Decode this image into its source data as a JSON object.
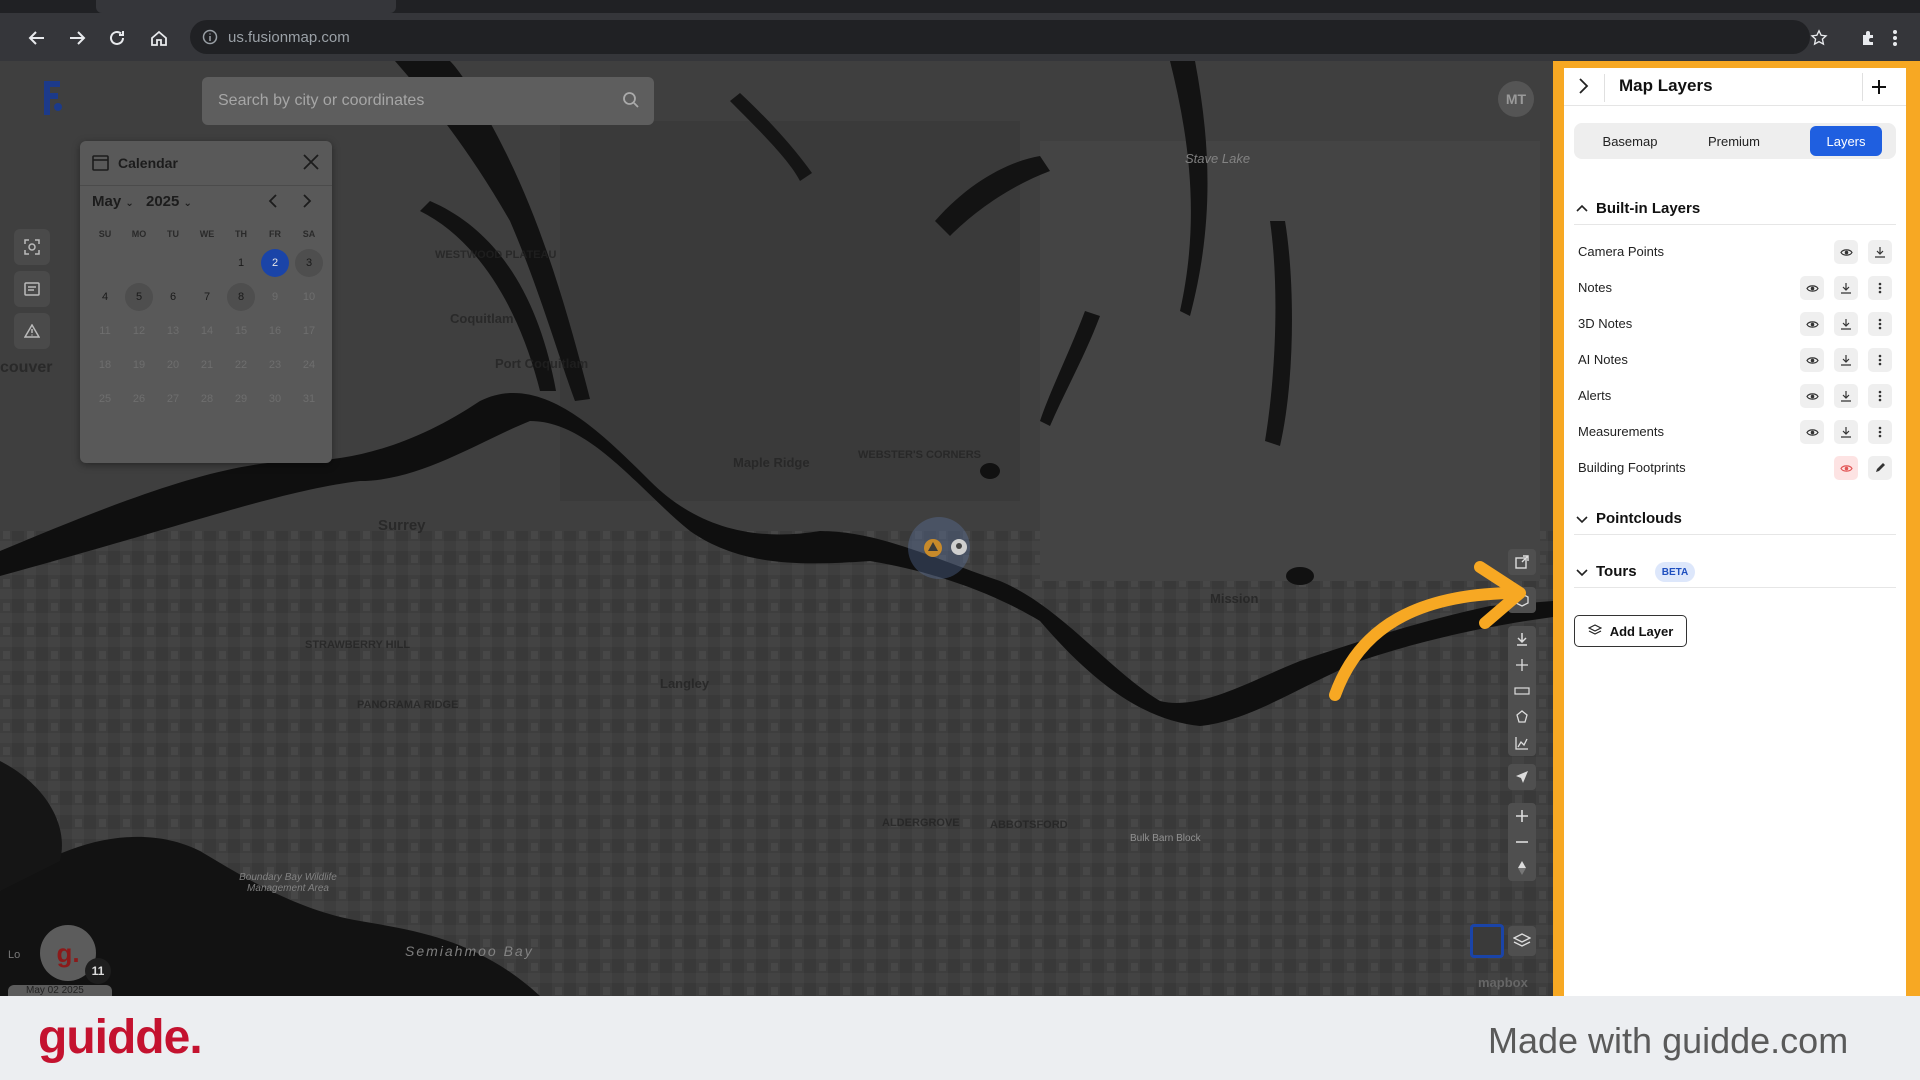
{
  "browser": {
    "url": "us.fusionmap.com"
  },
  "search": {
    "placeholder": "Search by city or coordinates"
  },
  "user": {
    "initials": "MT"
  },
  "calendar": {
    "title": "Calendar",
    "month": "May",
    "year": "2025",
    "weekdays": [
      "SU",
      "MO",
      "TU",
      "WE",
      "TH",
      "FR",
      "SA"
    ],
    "days": [
      {
        "d": "",
        "s": ""
      },
      {
        "d": "",
        "s": ""
      },
      {
        "d": "",
        "s": ""
      },
      {
        "d": "",
        "s": ""
      },
      {
        "d": "1",
        "s": ""
      },
      {
        "d": "2",
        "s": "sel"
      },
      {
        "d": "3",
        "s": "mark"
      },
      {
        "d": "4",
        "s": ""
      },
      {
        "d": "5",
        "s": "mark"
      },
      {
        "d": "6",
        "s": ""
      },
      {
        "d": "7",
        "s": ""
      },
      {
        "d": "8",
        "s": "mark"
      },
      {
        "d": "9",
        "s": "dim"
      },
      {
        "d": "10",
        "s": "dim"
      },
      {
        "d": "11",
        "s": "dim"
      },
      {
        "d": "12",
        "s": "dim"
      },
      {
        "d": "13",
        "s": "dim"
      },
      {
        "d": "14",
        "s": "dim"
      },
      {
        "d": "15",
        "s": "dim"
      },
      {
        "d": "16",
        "s": "dim"
      },
      {
        "d": "17",
        "s": "dim"
      },
      {
        "d": "18",
        "s": "dim"
      },
      {
        "d": "19",
        "s": "dim"
      },
      {
        "d": "20",
        "s": "dim"
      },
      {
        "d": "21",
        "s": "dim"
      },
      {
        "d": "22",
        "s": "dim"
      },
      {
        "d": "23",
        "s": "dim"
      },
      {
        "d": "24",
        "s": "dim"
      },
      {
        "d": "25",
        "s": "dim"
      },
      {
        "d": "26",
        "s": "dim"
      },
      {
        "d": "27",
        "s": "dim"
      },
      {
        "d": "28",
        "s": "dim"
      },
      {
        "d": "29",
        "s": "dim"
      },
      {
        "d": "30",
        "s": "dim"
      },
      {
        "d": "31",
        "s": "dim"
      }
    ]
  },
  "map": {
    "labels": [
      "couver",
      "Coquitlam",
      "Port Coquitlam",
      "Surrey",
      "Maple Ridge",
      "WEBSTER'S CORNERS",
      "STRAWBERRY HILL",
      "PANORAMA RIDGE",
      "ALDERGROVE",
      "ABBOTSFORD",
      "Mission",
      "Langley",
      "Bulk Barn Block",
      "Semiahmoo Bay",
      "Boundary Bay Wildlife Management Area",
      "WESTWOOD PLATEAU",
      "Stave Lake"
    ],
    "attribution": "mapbox",
    "notification_count": "11",
    "logo_alt": "Lo",
    "date_chip": "May 02 2025"
  },
  "panel": {
    "title": "Map Layers",
    "tabs": [
      "Basemap",
      "Premium",
      "Layers"
    ],
    "active_tab": "Layers",
    "sections": {
      "builtin": "Built-in Layers",
      "pointclouds": "Pointclouds",
      "tours": "Tours",
      "tours_badge": "BETA"
    },
    "layers": [
      {
        "name": "Camera Points"
      },
      {
        "name": "Notes"
      },
      {
        "name": "3D Notes"
      },
      {
        "name": "AI Notes"
      },
      {
        "name": "Alerts"
      },
      {
        "name": "Measurements"
      },
      {
        "name": "Building Footprints"
      }
    ],
    "add_layer": "Add Layer"
  },
  "footer": {
    "brand": "guidde.",
    "made_with": "Made with guidde.com"
  },
  "colors": {
    "accent": "#1f5fe0",
    "highlight_frame": "#f7a823",
    "brand": "#c4122f"
  }
}
